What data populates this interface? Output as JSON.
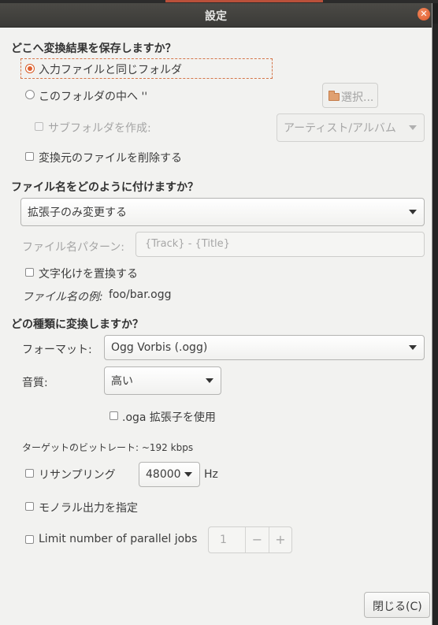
{
  "window": {
    "title": "設定",
    "close_glyph": "✕"
  },
  "output_location": {
    "heading": "どこへ変換結果を保存しますか？",
    "radio_same_folder": "入力ファイルと同じフォルダ",
    "radio_into_folder": "このフォルダの中へ ''",
    "choose_button": "選択...",
    "create_subfolders": "サブフォルダを作成:",
    "subfolder_pattern": "アーティスト/アルバム",
    "delete_original": "変換元のファイルを削除する",
    "selected": "same_folder"
  },
  "filename": {
    "heading": "ファイル名をどのように付けますか？",
    "mode": "拡張子のみ変更する",
    "pattern_label": "ファイル名パターン:",
    "pattern_placeholder": "{Track} - {Title}",
    "replace_garbled": "文字化けを置換する",
    "example_label": "ファイル名の例:",
    "example_value": "foo/bar.ogg"
  },
  "conversion": {
    "heading": "どの種類に変換しますか？",
    "format_label": "フォーマット:",
    "format_value": "Ogg Vorbis (.ogg)",
    "quality_label": "音質:",
    "quality_value": "高い",
    "oga_extension": ".oga 拡張子を使用",
    "target_bitrate": "ターゲットのビットレート: ~192 kbps",
    "resample_label": "リサンプリング",
    "resample_rate": "48000",
    "resample_unit": "Hz",
    "mono_output": "モノラル出力を指定",
    "limit_jobs_label": "Limit number of parallel jobs",
    "jobs_value": "1",
    "minus": "−",
    "plus": "+"
  },
  "footer": {
    "close_button": "閉じる(C)"
  }
}
